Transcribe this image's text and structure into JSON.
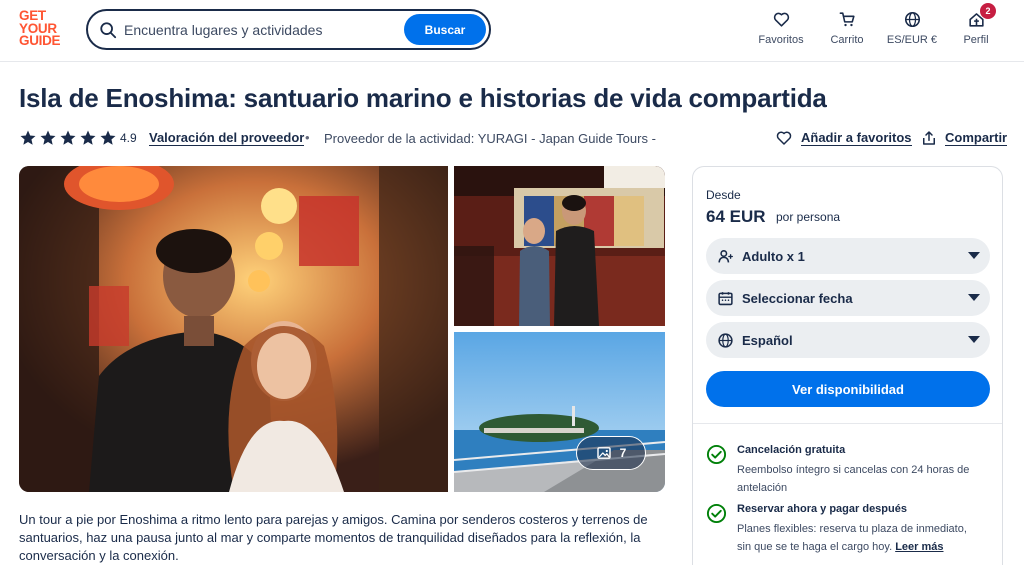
{
  "header": {
    "logo": [
      "GET",
      "YOUR",
      "GUIDE"
    ],
    "search_placeholder": "Encuentra lugares y actividades",
    "search_button": "Buscar",
    "nav": {
      "favorites": "Favoritos",
      "cart": "Carrito",
      "currency": "ES/EUR €",
      "profile": "Perfil",
      "profile_badge": "2"
    }
  },
  "product": {
    "title": "Isla de Enoshima: santuario marino e historias de vida compartida",
    "rating": "4.9",
    "rating_stars": 5,
    "provider_rating_link": "Valoración del proveedor",
    "separator": "•",
    "provider": "Proveedor de la actividad: YURAGI - Japan Guide Tours -",
    "add_favorites": "Añadir a favoritos",
    "share": "Compartir",
    "photo_count": "7",
    "description": "Un tour a pie por Enoshima a ritmo lento para parejas y amigos. Camina por senderos costeros y terrenos de santuarios, haz una pausa junto al mar y comparte momentos de tranquilidad diseñados para la reflexión, la conversación y la conexión."
  },
  "booking": {
    "from_label": "Desde",
    "price": "64 EUR",
    "per_person": "por persona",
    "participants": "Adulto x 1",
    "date": "Seleccionar fecha",
    "language": "Español",
    "check_button": "Ver disponibilidad",
    "features": [
      {
        "title": "Cancelación gratuita",
        "text": "Reembolso íntegro si cancelas con 24 horas de antelación"
      },
      {
        "title": "Reservar ahora y pagar después",
        "text": "Planes flexibles: reserva tu plaza de inmediato, sin que se te haga el cargo hoy.",
        "link": "Leer más"
      }
    ]
  },
  "colors": {
    "brand": "#ff5533",
    "primary": "#0071eb",
    "text": "#1a2b49",
    "success": "#008009"
  }
}
